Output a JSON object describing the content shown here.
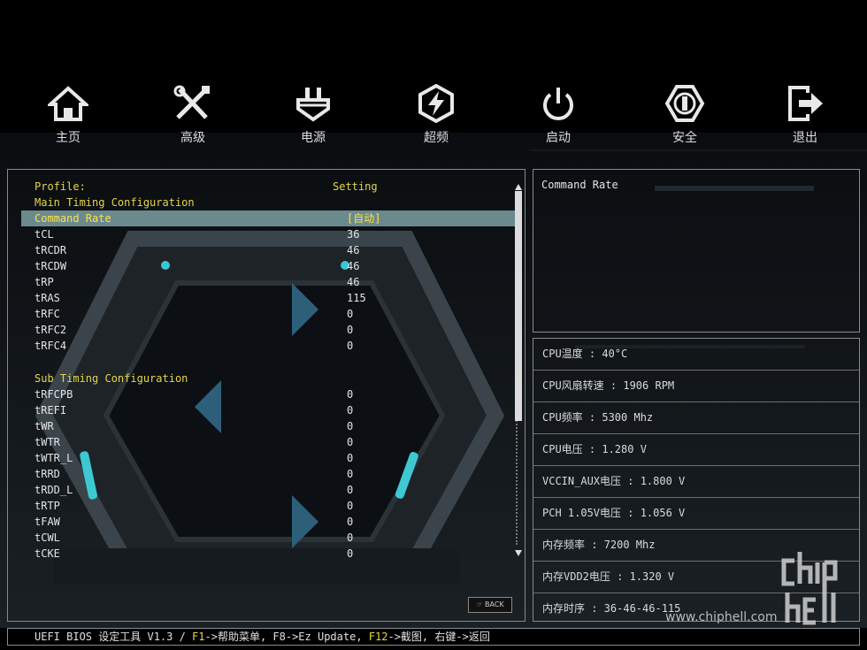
{
  "nav": [
    {
      "label": "主页",
      "icon": "home-icon"
    },
    {
      "label": "高级",
      "icon": "tools-icon"
    },
    {
      "label": "电源",
      "icon": "power-plug-icon"
    },
    {
      "label": "超频",
      "icon": "overclock-icon"
    },
    {
      "label": "启动",
      "icon": "power-icon"
    },
    {
      "label": "安全",
      "icon": "shield-icon"
    },
    {
      "label": "退出",
      "icon": "exit-icon"
    }
  ],
  "settings": {
    "profile_label": "Profile:",
    "setting_label": "Setting",
    "main_section": "Main Timing Configuration",
    "main_rows": [
      {
        "name": "Command Rate",
        "value": "[自动]"
      },
      {
        "name": "tCL",
        "value": "36"
      },
      {
        "name": "tRCDR",
        "value": "46"
      },
      {
        "name": "tRCDW",
        "value": "46"
      },
      {
        "name": "tRP",
        "value": "46"
      },
      {
        "name": "tRAS",
        "value": "115"
      },
      {
        "name": "tRFC",
        "value": "0"
      },
      {
        "name": "tRFC2",
        "value": "0"
      },
      {
        "name": "tRFC4",
        "value": "0"
      }
    ],
    "sub_section": "Sub Timing Configuration",
    "sub_rows": [
      {
        "name": "tRFCPB",
        "value": "0"
      },
      {
        "name": "tREFI",
        "value": "0"
      },
      {
        "name": "tWR",
        "value": "0"
      },
      {
        "name": "tWTR",
        "value": "0"
      },
      {
        "name": "tWTR_L",
        "value": "0"
      },
      {
        "name": "tRRD",
        "value": "0"
      },
      {
        "name": "tRDD_L",
        "value": "0"
      },
      {
        "name": "tRTP",
        "value": "0"
      },
      {
        "name": "tFAW",
        "value": "0"
      },
      {
        "name": "tCWL",
        "value": "0"
      },
      {
        "name": "tCKE",
        "value": "0"
      }
    ],
    "back_label": "BACK"
  },
  "help": {
    "title": "Command Rate"
  },
  "info": [
    "CPU温度 : 40°C",
    "CPU风扇转速 : 1906 RPM",
    "CPU频率 : 5300 Mhz",
    "CPU电压 : 1.280 V",
    "VCCIN_AUX电压 : 1.800 V",
    "PCH 1.05V电压 : 1.056 V",
    "内存频率 : 7200 Mhz",
    "内存VDD2电压 : 1.320 V",
    "内存时序 : 36-46-46-115"
  ],
  "footer": {
    "prefix": "UEFI BIOS 设定工具 V1.3 / ",
    "f1_key": "F1",
    "f1_text": "->帮助菜单, F8->Ez Update, ",
    "f12_key": "F12",
    "f12_text": "->截图, 右键->返回"
  },
  "watermark": {
    "url": "www.chiphell.com",
    "logo_text": "chip hell"
  },
  "colors": {
    "accent": "#e6d54a",
    "selected_row": "#6b8a8e",
    "selected_text": "#ffe04a",
    "border": "#8a8a8a"
  }
}
